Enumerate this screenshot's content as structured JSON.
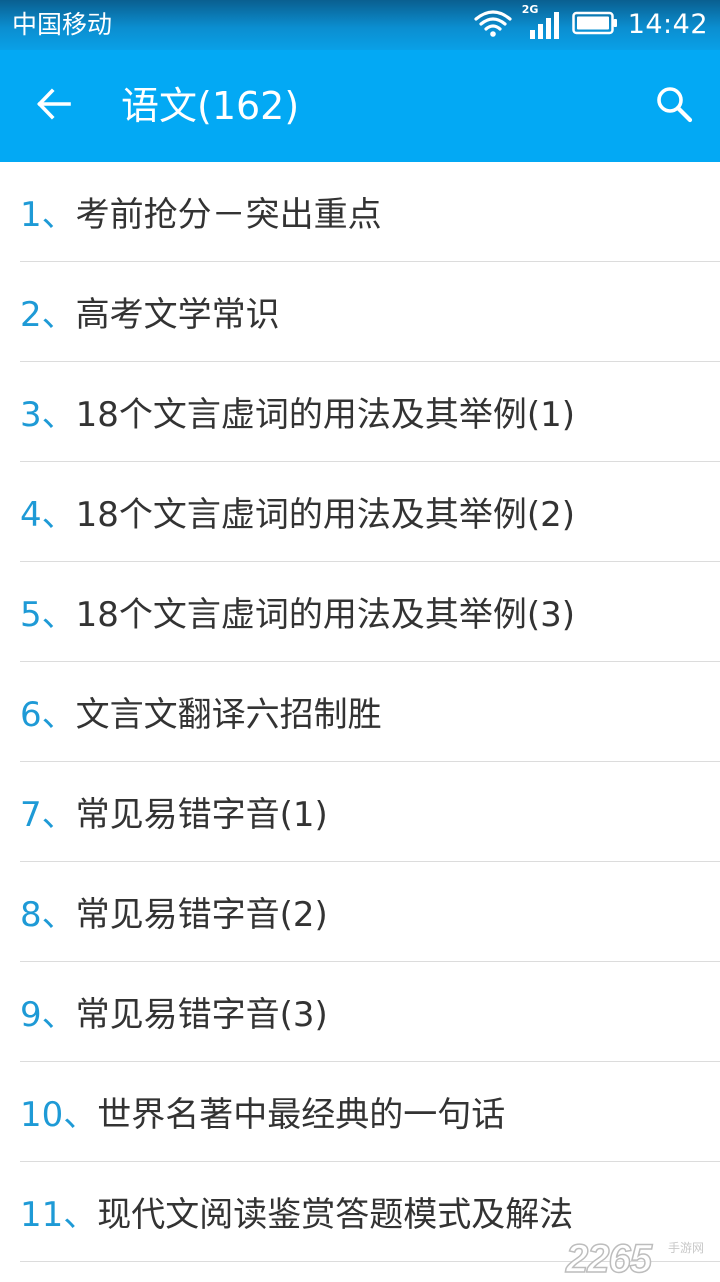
{
  "status_bar": {
    "carrier": "中国移动",
    "network_type": "2G",
    "time": "14:42",
    "icons": [
      "wifi-icon",
      "signal-icon",
      "battery-icon"
    ]
  },
  "app_bar": {
    "title": "语文(162)",
    "back_icon": "back-arrow-icon",
    "search_icon": "search-icon",
    "color": "#03a9f4"
  },
  "list": {
    "index_color": "#1e9ad6",
    "items": [
      {
        "index": "1、",
        "title": "考前抢分－突出重点"
      },
      {
        "index": "2、",
        "title": "高考文学常识"
      },
      {
        "index": "3、",
        "title": "18个文言虚词的用法及其举例(1)"
      },
      {
        "index": "4、",
        "title": "18个文言虚词的用法及其举例(2)"
      },
      {
        "index": "5、",
        "title": "18个文言虚词的用法及其举例(3)"
      },
      {
        "index": "6、",
        "title": "文言文翻译六招制胜"
      },
      {
        "index": "7、",
        "title": "常见易错字音(1)"
      },
      {
        "index": "8、",
        "title": "常见易错字音(2)"
      },
      {
        "index": "9、",
        "title": "常见易错字音(3)"
      },
      {
        "index": "10、",
        "title": "世界名著中最经典的一句话"
      },
      {
        "index": "11、",
        "title": "现代文阅读鉴赏答题模式及解法"
      }
    ]
  },
  "watermark": {
    "text": "2265",
    "subtext": "手游网"
  }
}
